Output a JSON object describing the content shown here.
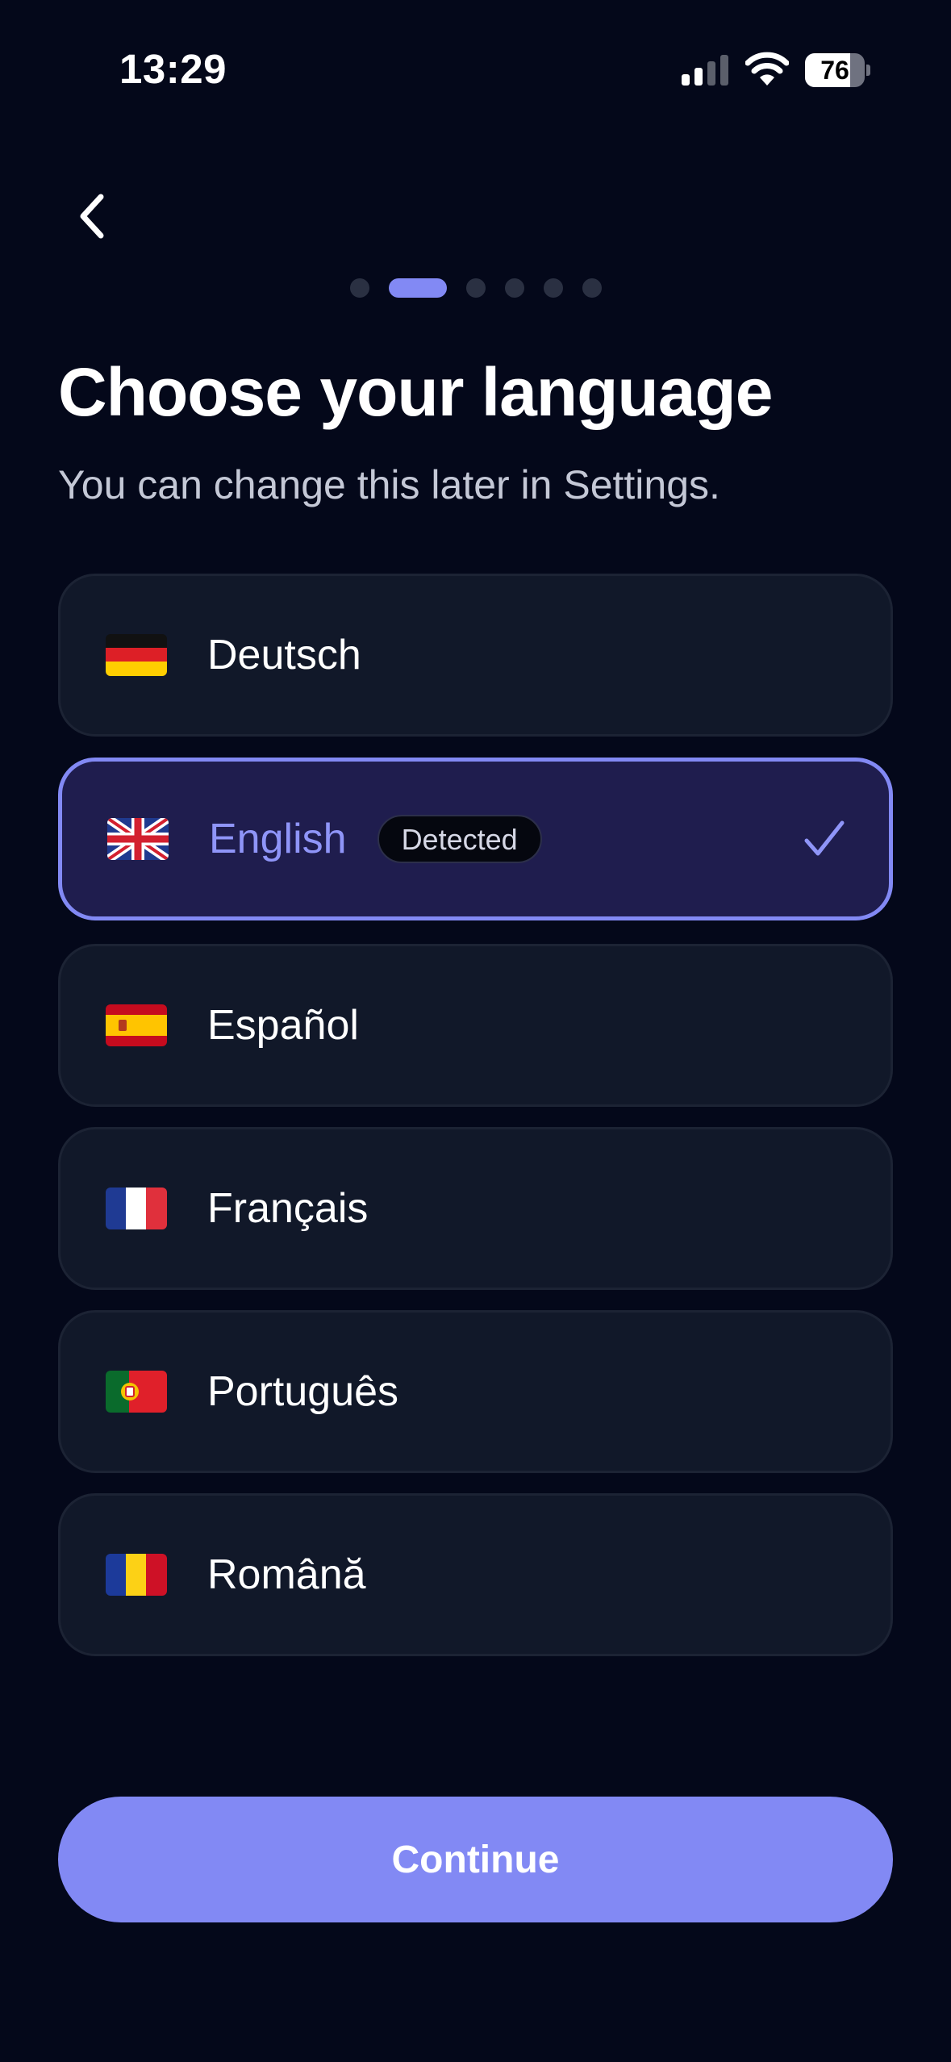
{
  "status_bar": {
    "time": "13:29",
    "battery_level": 76,
    "battery_fill_fraction": 0.76
  },
  "header": {
    "back_icon": "chevron-left-icon",
    "progress": {
      "total_steps": 6,
      "current_step": 2
    }
  },
  "content": {
    "title": "Choose your language",
    "subtitle": "You can change this later in Settings."
  },
  "languages": [
    {
      "label": "Deutsch",
      "flag": "germany-flag-icon",
      "selected": false
    },
    {
      "label": "English",
      "flag": "united-kingdom-flag-icon",
      "selected": true,
      "badge": "Detected"
    },
    {
      "label": "Español",
      "flag": "spain-flag-icon",
      "selected": false
    },
    {
      "label": "Français",
      "flag": "france-flag-icon",
      "selected": false
    },
    {
      "label": "Português",
      "flag": "portugal-flag-icon",
      "selected": false
    },
    {
      "label": "Română",
      "flag": "romania-flag-icon",
      "selected": false
    }
  ],
  "footer": {
    "continue_label": "Continue"
  },
  "colors": {
    "background": "#04081a",
    "accent": "#8289f4",
    "card": "#111829",
    "selected_card": "#1f1d4e"
  }
}
